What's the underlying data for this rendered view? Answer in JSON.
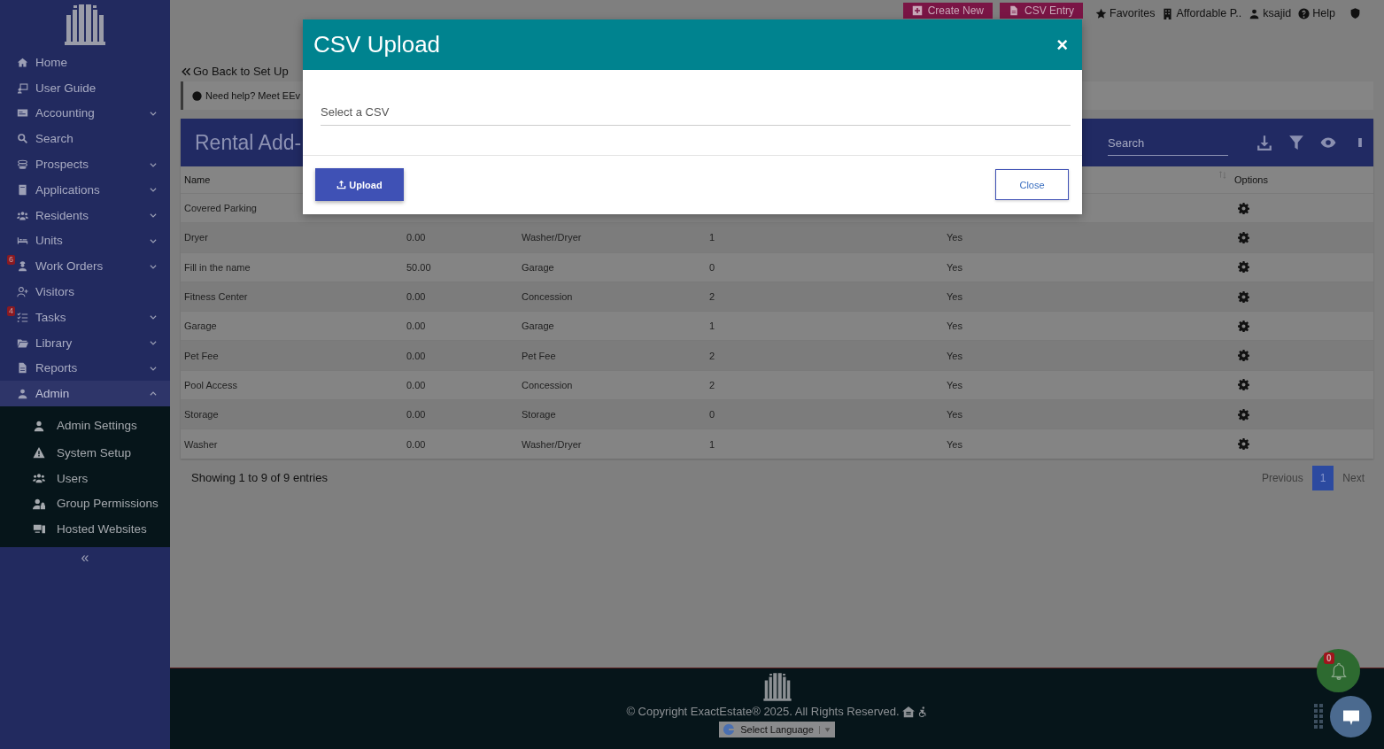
{
  "sidebar": {
    "collapse_label": "«",
    "items": [
      {
        "label": "Home",
        "kind": "link",
        "selected": false
      },
      {
        "label": "User Guide",
        "kind": "link",
        "selected": false
      },
      {
        "label": "Accounting",
        "kind": "menu",
        "expanded": false,
        "selected": false
      },
      {
        "label": "Search",
        "kind": "link",
        "selected": false
      },
      {
        "label": "Prospects",
        "kind": "menu",
        "expanded": false,
        "selected": false
      },
      {
        "label": "Applications",
        "kind": "menu",
        "expanded": false,
        "selected": false
      },
      {
        "label": "Residents",
        "kind": "menu",
        "expanded": false,
        "selected": false
      },
      {
        "label": "Units",
        "kind": "menu",
        "expanded": false,
        "selected": false
      },
      {
        "label": "Work Orders",
        "kind": "menu",
        "expanded": false,
        "selected": false,
        "badge": "6"
      },
      {
        "label": "Visitors",
        "kind": "link",
        "selected": false
      },
      {
        "label": "Tasks",
        "kind": "menu",
        "expanded": false,
        "selected": false,
        "badge": "4"
      },
      {
        "label": "Library",
        "kind": "menu",
        "expanded": false,
        "selected": false
      },
      {
        "label": "Reports",
        "kind": "menu",
        "expanded": false,
        "selected": false
      },
      {
        "label": "Admin",
        "kind": "menu",
        "expanded": true,
        "selected": true,
        "children": [
          {
            "label": "Admin Settings"
          },
          {
            "label": "System Setup"
          },
          {
            "label": "Users"
          },
          {
            "label": "Group Permissions"
          },
          {
            "label": "Hosted Websites"
          }
        ]
      }
    ]
  },
  "top_bar": {
    "buttons": [
      "Create New",
      "CSV Entry"
    ],
    "links": [
      "Favorites",
      "Affordable P..",
      "ksajid",
      "Help"
    ]
  },
  "back_link": "Go Back to Set Up",
  "help_notice": "Need help? Meet EEv",
  "page_title": "Rental Add-",
  "search": {
    "placeholder": "Search"
  },
  "table": {
    "name_header": "Name",
    "options_header": "Options",
    "rows": [
      {
        "name": "Covered Parking"
      },
      {
        "name": "Dryer",
        "column_2": "0.00",
        "column_3": "Washer/Dryer",
        "column_4": "1",
        "column_5": "Yes"
      },
      {
        "name": "Fill in the name",
        "column_2": "50.00",
        "column_3": "Garage",
        "column_4": "0",
        "column_5": "Yes"
      },
      {
        "name": "Fitness Center",
        "column_2": "0.00",
        "column_3": "Concession",
        "column_4": "2",
        "column_5": "Yes"
      },
      {
        "name": "Garage",
        "column_2": "0.00",
        "column_3": "Garage",
        "column_4": "1",
        "column_5": "Yes"
      },
      {
        "name": "Pet Fee",
        "column_2": "0.00",
        "column_3": "Pet Fee",
        "column_4": "2",
        "column_5": "Yes"
      },
      {
        "name": "Pool Access",
        "column_2": "0.00",
        "column_3": "Concession",
        "column_4": "2",
        "column_5": "Yes"
      },
      {
        "name": "Storage",
        "column_2": "0.00",
        "column_3": "Storage",
        "column_4": "0",
        "column_5": "Yes"
      },
      {
        "name": "Washer",
        "column_2": "0.00",
        "column_3": "Washer/Dryer",
        "column_4": "1",
        "column_5": "Yes"
      }
    ]
  },
  "entries_info": "Showing 1 to 9 of 9 entries",
  "pagination": {
    "previous": "Previous",
    "next": "Next",
    "pages": [
      {
        "label": "1",
        "selected": true
      }
    ]
  },
  "footer": {
    "copyright": "© Copyright ExactEstate® 2025. All Rights Reserved.",
    "language": "Select Language"
  },
  "notifications": {
    "badge": "0"
  },
  "modal": {
    "title": "CSV Upload",
    "close_symbol": "×",
    "field": {
      "placeholder": "Select a CSV"
    },
    "buttons": [
      "Upload",
      "Close"
    ]
  }
}
